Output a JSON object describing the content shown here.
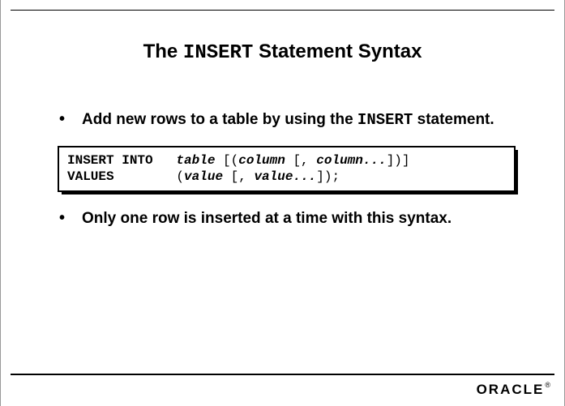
{
  "title": {
    "pre": "The ",
    "keyword": "INSERT",
    "post": " Statement Syntax"
  },
  "bullets": {
    "b1": {
      "pre": "Add new rows to a table by using the ",
      "keyword": "INSERT",
      "post": " statement."
    },
    "b2": "Only one row is inserted at a time with this syntax."
  },
  "code": {
    "kw1": "INSERT INTO   ",
    "it1": "table ",
    "pl1": "[(",
    "it2": "column ",
    "pl2": "[, ",
    "it3": "column...",
    "pl3": "])]",
    "kw2": "VALUES        ",
    "pl4": "(",
    "it4": "value ",
    "pl5": "[, ",
    "it5": "value...",
    "pl6": "]);"
  },
  "brand": "ORACLE"
}
